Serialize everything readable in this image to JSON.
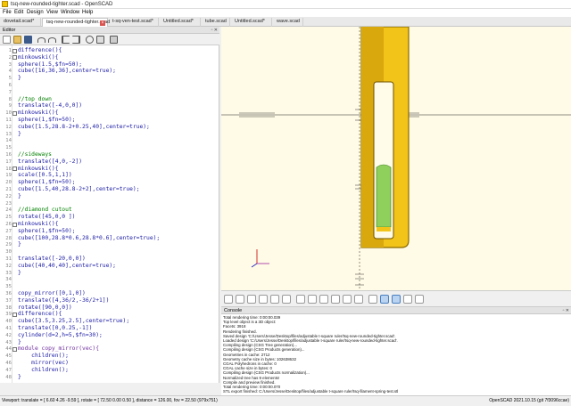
{
  "window": {
    "title": "tsq-new-rounded-tighter.scad - OpenSCAD"
  },
  "menu": [
    "File",
    "Edit",
    "Design",
    "View",
    "Window",
    "Help"
  ],
  "tabs": [
    {
      "label": "dovetail.scad*"
    },
    {
      "label": "tsq-new-rounded-tighter.scad",
      "active": true
    },
    {
      "label": "t-sq-ven-test.scad*"
    },
    {
      "label": "Untitled.scad*"
    },
    {
      "label": "tube.scad"
    },
    {
      "label": "Untitled.scad*"
    },
    {
      "label": "wave.scad"
    }
  ],
  "editor": {
    "title": "Editor",
    "lines": [
      {
        "n": "1",
        "text": "difference(){",
        "fold": true
      },
      {
        "n": "2",
        "text": "minkowski(){",
        "fold": true
      },
      {
        "n": "3",
        "text": "sphere(1.5,$fn=50);"
      },
      {
        "n": "4",
        "text": "cube([16,36,36],center=true);"
      },
      {
        "n": "5",
        "text": "}"
      },
      {
        "n": "6",
        "text": ""
      },
      {
        "n": "7",
        "text": ""
      },
      {
        "n": "8",
        "text": "//top down",
        "type": "cm"
      },
      {
        "n": "9",
        "text": "translate([-4,0,0])"
      },
      {
        "n": "10",
        "text": "minkowski(){",
        "fold": true
      },
      {
        "n": "11",
        "text": "sphere(1,$fn=50);"
      },
      {
        "n": "12",
        "text": "cube([1.5,28.8-2+0.25,40],center=true);"
      },
      {
        "n": "13",
        "text": "}"
      },
      {
        "n": "14",
        "text": ""
      },
      {
        "n": "15",
        "text": ""
      },
      {
        "n": "16",
        "text": "//sideways",
        "type": "cm"
      },
      {
        "n": "17",
        "text": "translate([4,0,-2])"
      },
      {
        "n": "18",
        "text": "minkowski(){",
        "fold": true
      },
      {
        "n": "19",
        "text": "scale([0.5,1,1])"
      },
      {
        "n": "20",
        "text": "sphere(1,$fn=50);"
      },
      {
        "n": "21",
        "text": "cube([1.5,40,28.8-2+2],center=true);"
      },
      {
        "n": "22",
        "text": "}"
      },
      {
        "n": "23",
        "text": ""
      },
      {
        "n": "24",
        "text": "//diamond cutout",
        "type": "cm"
      },
      {
        "n": "25",
        "text": "rotate([45,0,0 ])"
      },
      {
        "n": "26",
        "text": "minkowski(){",
        "fold": true
      },
      {
        "n": "27",
        "text": "sphere(1,$fn=50);"
      },
      {
        "n": "28",
        "text": "cube([100,28.8*0.6,28.8*0.6],center=true);"
      },
      {
        "n": "29",
        "text": "}"
      },
      {
        "n": "30",
        "text": ""
      },
      {
        "n": "31",
        "text": "translate([-20,0,0])"
      },
      {
        "n": "32",
        "text": "cube([40,40,40],center=true);"
      },
      {
        "n": "33",
        "text": "}"
      },
      {
        "n": "34",
        "text": ""
      },
      {
        "n": "35",
        "text": ""
      },
      {
        "n": "36",
        "text": "copy_mirror([0,1,0])"
      },
      {
        "n": "37",
        "text": "translate([4,36/2,-36/2+1])"
      },
      {
        "n": "38",
        "text": "rotate([90,0,0])"
      },
      {
        "n": "39",
        "text": "difference(){",
        "fold": true
      },
      {
        "n": "40",
        "text": "cube([3.5,3.25,2.5],center=true);"
      },
      {
        "n": "41",
        "text": "translate([0,0.25,-1])"
      },
      {
        "n": "42",
        "text": "cylinder(d=2,h=5,$fn=30);"
      },
      {
        "n": "43",
        "text": "}"
      },
      {
        "n": "44",
        "text": "module copy_mirror(vec){",
        "fold": true,
        "type": "kw"
      },
      {
        "n": "45",
        "text": "    children();"
      },
      {
        "n": "46",
        "text": "    mirror(vec)"
      },
      {
        "n": "47",
        "text": "    children();"
      },
      {
        "n": "48",
        "text": "}"
      }
    ]
  },
  "console": {
    "title": "Console",
    "lines": [
      "Total rendering time: 0:00:00.039",
      "Top level object is a 3D object:",
      "    Facets:       3918",
      "Rendering finished.",
      "Saved design 'C:/Users/Jesse/Desktop/files/adjustable t-square ruler/tsq-new-rounded-tighter.scad'.",
      "Loaded design 'C:/Users/Jesse/Desktop/files/adjustable t-square ruler/tsq-new-rounded-tighter.scad'.",
      "Compiling design (CSG Tree generation)...",
      "Compiling design (CSG Products generation)...",
      "Geometries in cache: 2712",
      "Geometry cache size in bytes: 102638632",
      "CGAL Polyhedrons in cache: 0",
      "CGAL cache size in bytes: 0",
      "Compiling design (CSG Products normalization)...",
      "Normalized tree has 9 elements!",
      "Compile and preview finished.",
      "Total rendering time: 0:00:00.070",
      "STL export finished: C:/Users/Jesse/Desktop/files/adjustable t-square ruler/tsq-filament-spring-test.stl"
    ]
  },
  "status": {
    "viewport": "Viewport: translate = [ 6.60 4.26 -9.59 ], rotate = [ 72.50 0.00 0.50 ], distance = 126.00, fov = 22.50 (979x751)",
    "version": "OpenSCAD 2021.10.15 (git 7f3096ccae)"
  },
  "colors": {
    "model": "#f2c318",
    "model_edge": "#8a6a00",
    "model_cut": "#8fcf5c",
    "viewport_bg": "#fffbe6"
  }
}
